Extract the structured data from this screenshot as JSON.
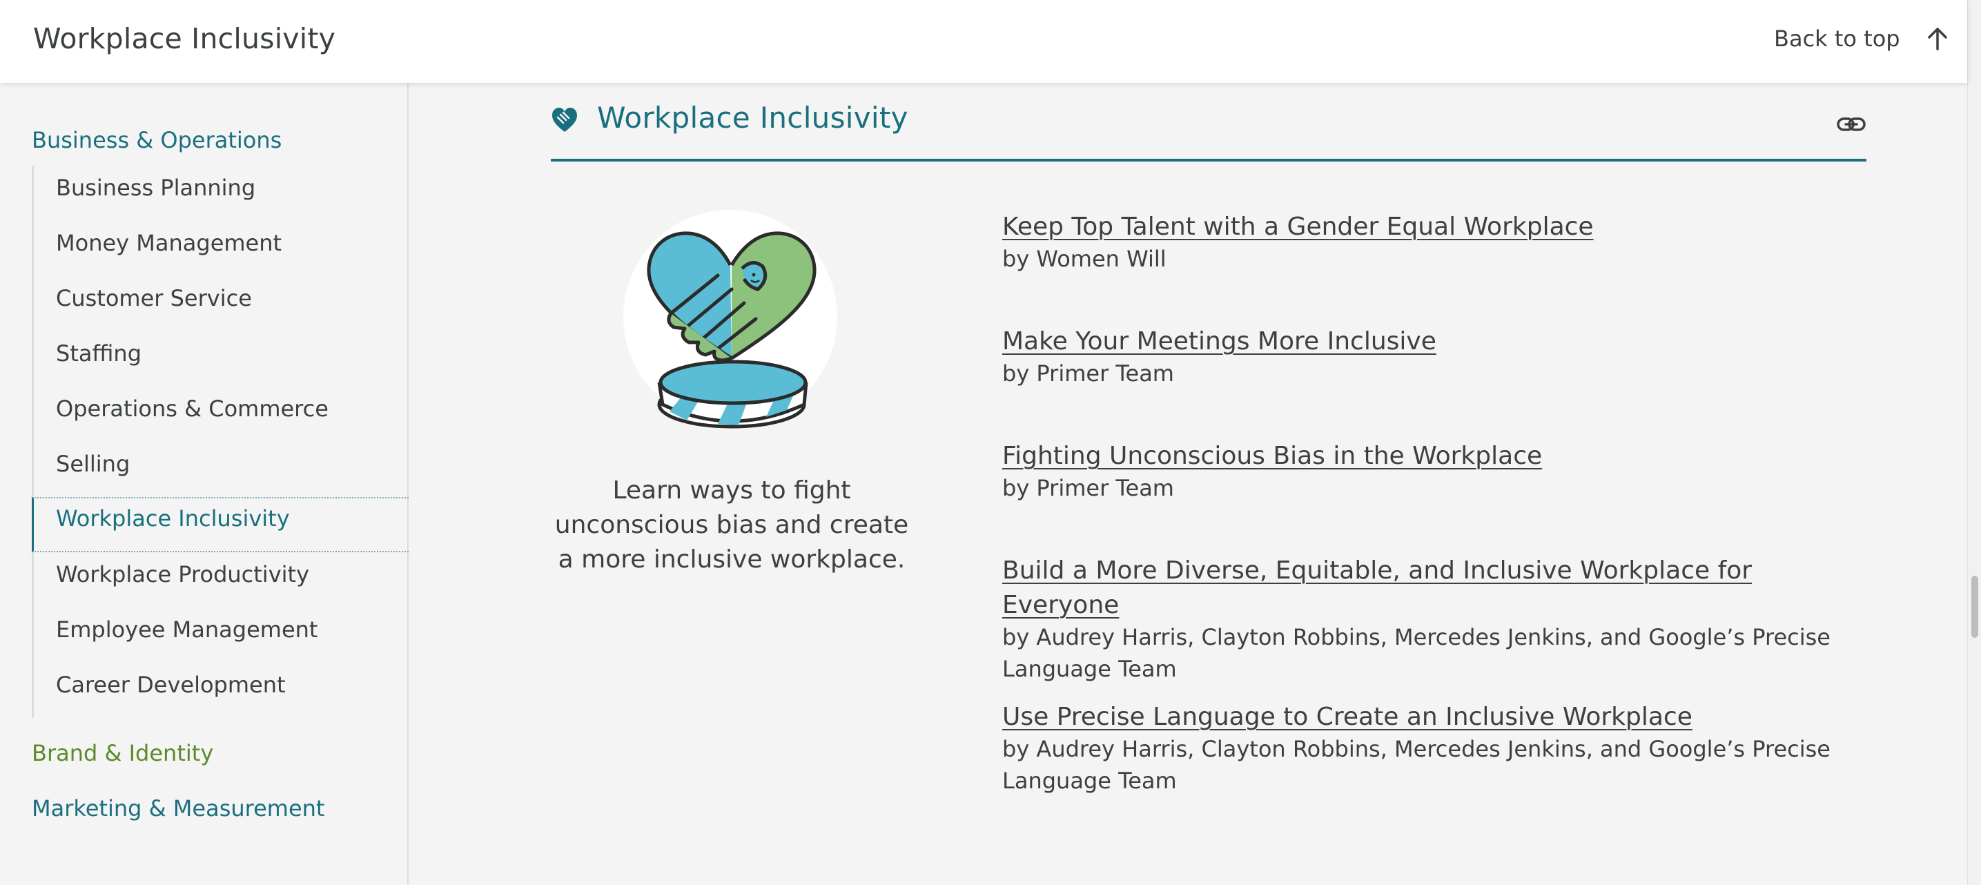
{
  "header": {
    "title": "Workplace Inclusivity",
    "back_to_top": "Back to top"
  },
  "sidebar": {
    "sections": [
      {
        "label": "Business & Operations"
      },
      {
        "label": "Brand & Identity"
      },
      {
        "label": "Marketing & Measurement"
      }
    ],
    "items": [
      {
        "label": "Business Planning"
      },
      {
        "label": "Money Management"
      },
      {
        "label": "Customer Service"
      },
      {
        "label": "Staffing"
      },
      {
        "label": "Operations & Commerce"
      },
      {
        "label": "Selling"
      },
      {
        "label": "Workplace Inclusivity"
      },
      {
        "label": "Workplace Productivity"
      },
      {
        "label": "Employee Management"
      },
      {
        "label": "Career Development"
      }
    ],
    "active_item": "Workplace Inclusivity"
  },
  "main": {
    "section_title": "Workplace Inclusivity",
    "section_icon": "heart-hands-icon",
    "description": "Learn ways to fight unconscious bias and create a more inclusive workplace.",
    "resources": [
      {
        "title": "Keep Top Talent with a Gender Equal Workplace",
        "author": "by Women Will"
      },
      {
        "title": "Make Your Meetings More Inclusive",
        "author": "by Primer Team"
      },
      {
        "title": "Fighting Unconscious Bias in the Workplace",
        "author": "by Primer Team"
      },
      {
        "title": "Build a More Diverse, Equitable, and Inclusive Workplace for Everyone",
        "author": "by Audrey Harris, Clayton Robbins, Mercedes Jenkins, and Google’s Precise Language Team"
      },
      {
        "title": "Use Precise Language to Create an Inclusive Workplace",
        "author": "by Audrey Harris, Clayton Robbins, Mercedes Jenkins, and Google’s Precise Language Team"
      }
    ]
  },
  "colors": {
    "accent_teal": "#1a6f7e",
    "accent_green": "#5b8a2b",
    "background": "#f4f4f4"
  }
}
